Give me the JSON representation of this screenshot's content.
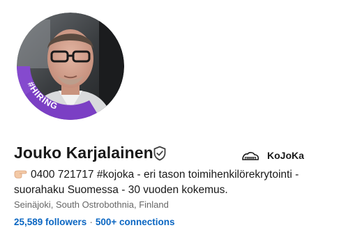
{
  "profile": {
    "name": "Jouko Karjalainen",
    "headline_prefix_icon": "pointing-hand-emoji",
    "headline": "0400 721717 #kojoka - eri tason toimihenkilörekrytointi - suorahaku Suomessa - 30 vuoden kokemus.",
    "location": "Seinäjoki, South Ostrobothnia, Finland",
    "followers": "25,589 followers",
    "separator": "·",
    "connections": "500+ connections",
    "avatar_frame_text": "#HIRING",
    "verified_icon": "verified-shield-icon"
  },
  "company": {
    "name": "KoJoKa",
    "logo_icon": "kojoka-logo"
  },
  "colors": {
    "hiring_frame": "#7b3fc4",
    "link_blue": "#0a66c2",
    "text_primary": "#191919",
    "text_secondary": "#666666"
  }
}
